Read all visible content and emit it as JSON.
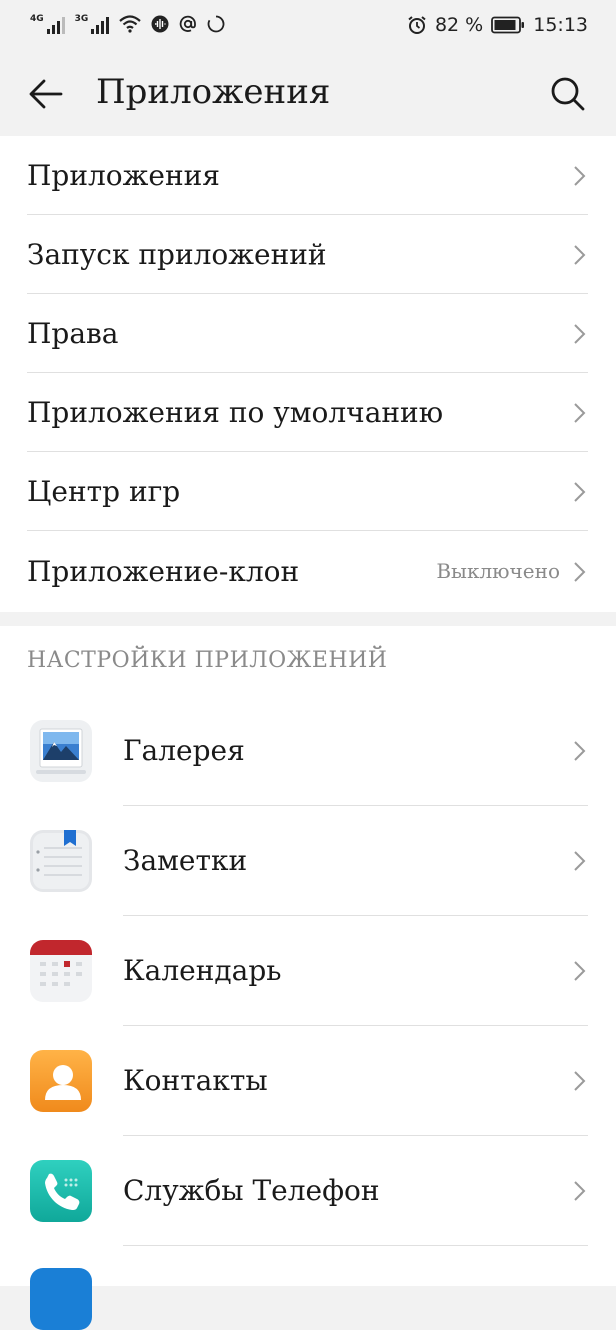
{
  "status_bar": {
    "sim1": "4G",
    "sim2": "3G",
    "battery_percent": "82 %",
    "time": "15:13",
    "icons": [
      "signal-icon",
      "wifi-icon",
      "shazam-icon",
      "at-icon",
      "loading-icon",
      "alarm-icon",
      "battery-icon"
    ]
  },
  "app_bar": {
    "title": "Приложения"
  },
  "menu": [
    {
      "label": "Приложения"
    },
    {
      "label": "Запуск приложений"
    },
    {
      "label": "Права"
    },
    {
      "label": "Приложения по умолчанию"
    },
    {
      "label": "Центр игр"
    },
    {
      "label": "Приложение-клон",
      "status": "Выключено"
    }
  ],
  "app_settings": {
    "header": "НАСТРОЙКИ ПРИЛОЖЕНИЙ",
    "apps": [
      {
        "label": "Галерея",
        "icon": "gallery-icon"
      },
      {
        "label": "Заметки",
        "icon": "notes-icon"
      },
      {
        "label": "Календарь",
        "icon": "calendar-icon"
      },
      {
        "label": "Контакты",
        "icon": "contacts-icon"
      },
      {
        "label": "Службы Телефон",
        "icon": "phone-icon"
      }
    ]
  }
}
